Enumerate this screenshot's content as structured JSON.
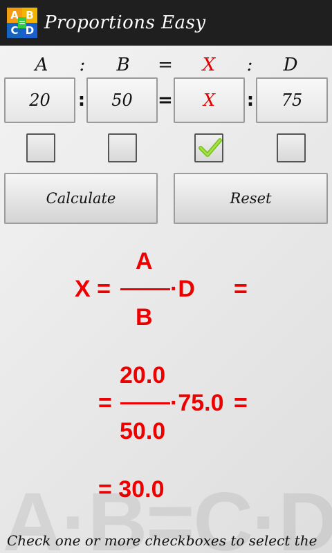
{
  "app": {
    "title": "Proportions Easy",
    "logo": {
      "a": "A",
      "sep1": ":",
      "b": "B",
      "eq": "=",
      "c": "C",
      "sep2": ":",
      "d": "D"
    }
  },
  "header": {
    "a": "A",
    "sep1": ":",
    "b": "B",
    "eq": "=",
    "x": "X",
    "sep2": ":",
    "d": "D"
  },
  "inputs": {
    "a_value": "20",
    "sep1": ":",
    "b_value": "50",
    "eq": "=",
    "x_value": "X",
    "sep2": ":",
    "d_value": "75"
  },
  "checkboxes": {
    "a_checked": false,
    "b_checked": false,
    "x_checked": true,
    "d_checked": false
  },
  "buttons": {
    "calculate": "Calculate",
    "reset": "Reset"
  },
  "formula": {
    "lhs": "X =",
    "num": "A",
    "den": "B",
    "mult": "·D",
    "eq1": "=",
    "eq2": "=",
    "num_val": "20.0",
    "den_val": "50.0",
    "mult_val": "·75.0",
    "eq3": "=",
    "result": "= 30.0"
  },
  "watermark": "A·B=C·D",
  "hint": "Check one or more checkboxes to select the",
  "colors": {
    "action_bar": "#1f1f1f",
    "formula": "#ee0000",
    "unknown": "#e00000",
    "check": "#7cc31f"
  }
}
